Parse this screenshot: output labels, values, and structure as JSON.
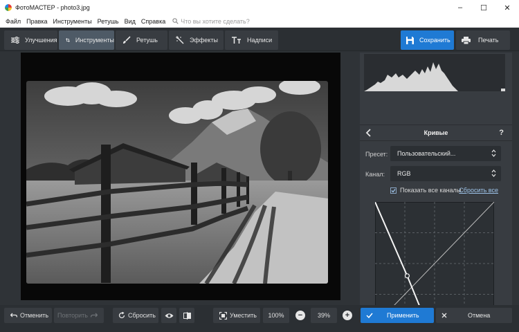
{
  "window": {
    "title": "ФотоМАСТЕР - photo3.jpg",
    "minimize": "–",
    "maximize": "☐",
    "close": "✕"
  },
  "menu": {
    "items": [
      "Файл",
      "Правка",
      "Инструменты",
      "Ретушь",
      "Вид",
      "Справка"
    ],
    "search_placeholder": "Что вы хотите сделать?"
  },
  "toolbar": {
    "tabs": [
      {
        "label": "Улучшения",
        "icon": "sliders-icon"
      },
      {
        "label": "Инструменты",
        "icon": "crop-icon",
        "active": true
      },
      {
        "label": "Ретушь",
        "icon": "brush-icon"
      },
      {
        "label": "Эффекты",
        "icon": "magic-wand-icon"
      },
      {
        "label": "Надписи",
        "icon": "text-icon"
      }
    ],
    "save_label": "Сохранить",
    "print_label": "Печать"
  },
  "curves_panel": {
    "title": "Кривые",
    "help": "?",
    "preset_label": "Пресет:",
    "preset_value": "Пользовательский...",
    "channel_label": "Канал:",
    "channel_value": "RGB",
    "show_all_channels": "Показать все каналы",
    "show_all_checked": true,
    "reset_all": "Сбросить все",
    "curve_points": [
      [
        0,
        1.0
      ],
      [
        0.27,
        0.4
      ],
      [
        0.38,
        0.14
      ],
      [
        0.48,
        0.0
      ],
      [
        1.0,
        0.0
      ]
    ]
  },
  "bottom": {
    "undo": "Отменить",
    "redo": "Повторить",
    "reset": "Сбросить",
    "fit": "Уместить",
    "zoom_100": "100%",
    "zoom_minus": "−",
    "zoom_value": "39%",
    "zoom_plus": "+",
    "apply": "Применить",
    "cancel": "Отмена"
  },
  "colors": {
    "accent": "#1f7ad4",
    "panel": "#383c41",
    "background": "#2f3337"
  }
}
